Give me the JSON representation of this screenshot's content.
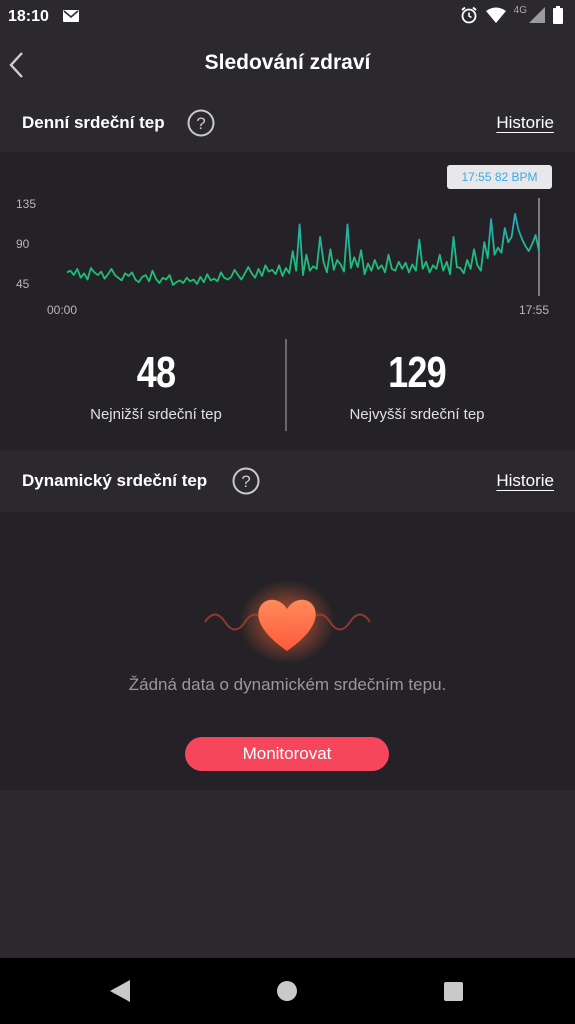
{
  "status_bar": {
    "time": "18:10",
    "network_label": "4G",
    "icons": [
      "mail-icon",
      "alarm-icon",
      "wifi-icon",
      "signal-icon",
      "battery-icon"
    ]
  },
  "app_bar": {
    "title": "Sledování zdraví",
    "back_icon": "chevron-left-icon"
  },
  "daily_section": {
    "title": "Denní srdeční tep",
    "help_icon": "question-circle-icon",
    "history_label": "Historie"
  },
  "chart_data": {
    "type": "line",
    "title": "",
    "xlabel": "",
    "ylabel": "",
    "tooltip": "17:55 82 BPM",
    "y_ticks": [
      135,
      90,
      45
    ],
    "x_ticks": [
      "00:00",
      "17:55"
    ],
    "ylim": [
      45,
      140
    ],
    "grid": false,
    "legend": "none",
    "colors": {
      "low": "#1fbf6a",
      "high": "#2f9ad9",
      "cursor": "#9a999c"
    },
    "series": [
      {
        "values": [
          58,
          60,
          55,
          62,
          52,
          57,
          50,
          63,
          58,
          55,
          59,
          51,
          56,
          62,
          55,
          52,
          49,
          57,
          54,
          58,
          50,
          47,
          53,
          55,
          48,
          60,
          51,
          46,
          52,
          50,
          55,
          44,
          47,
          49,
          46,
          52,
          48,
          50,
          45,
          53,
          47,
          56,
          49,
          51,
          48,
          58,
          52,
          50,
          53,
          61,
          55,
          50,
          57,
          64,
          57,
          52,
          62,
          54,
          66,
          59,
          61,
          56,
          66,
          54,
          63,
          57,
          82,
          60,
          112,
          55,
          78,
          60,
          65,
          62,
          98,
          70,
          58,
          84,
          61,
          72,
          67,
          59,
          112,
          63,
          75,
          64,
          83,
          56,
          68,
          60,
          72,
          62,
          66,
          58,
          78,
          62,
          60,
          70,
          62,
          69,
          58,
          67,
          60,
          95,
          62,
          70,
          58,
          66,
          62,
          78,
          60,
          70,
          56,
          98,
          64,
          63,
          57,
          72,
          62,
          84,
          66,
          60,
          92,
          74,
          118,
          78,
          86,
          80,
          108,
          92,
          98,
          124,
          106,
          96,
          88,
          82,
          90,
          100,
          82
        ]
      }
    ]
  },
  "stats": {
    "min_value": "48",
    "min_label": "Nejnižší srdeční tep",
    "max_value": "129",
    "max_label": "Nejvyšší srdeční tep"
  },
  "dynamic_section": {
    "title": "Dynamický srdeční tep",
    "help_icon": "question-circle-icon",
    "history_label": "Historie",
    "empty_message": "Žádná data o dynamickém srdečním tepu.",
    "monitor_button": "Monitorovat",
    "heart_icon": "heart-icon"
  },
  "nav_bar": {
    "icons": [
      "nav-back-icon",
      "nav-home-icon",
      "nav-recents-icon"
    ]
  }
}
